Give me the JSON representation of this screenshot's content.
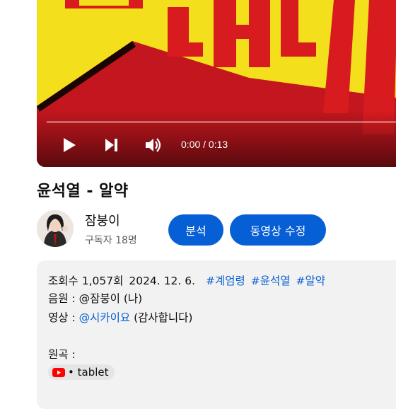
{
  "player": {
    "time": "0:00 / 0:13",
    "progress": 0.0
  },
  "video": {
    "title": "윤석열 - 알약"
  },
  "channel": {
    "name": "잠붕이",
    "subscribers": "구독자 18명"
  },
  "actions": {
    "analyze_label": "분석",
    "edit_label": "동영상 수정"
  },
  "description": {
    "views": "조회수 1,057회",
    "date": "2024. 12. 6.",
    "hashtags": [
      "#계엄령",
      "#윤석열",
      "#알약"
    ],
    "audio_prefix": "음원 : ",
    "audio_text": "@잠붕이 (나)",
    "video_prefix": "영상 : ",
    "video_mention": "@시카이요",
    "video_suffix": " (감사합니다)",
    "original_label": "원곡 :",
    "chip_label": "• tablet"
  },
  "colors": {
    "accent": "#065fd4",
    "progress": "#ff0000",
    "thumbnail_yellow": "#f4df1c",
    "thumbnail_red": "#c8141c"
  },
  "icons": [
    "play-icon",
    "next-icon",
    "volume-icon",
    "youtube-icon"
  ]
}
